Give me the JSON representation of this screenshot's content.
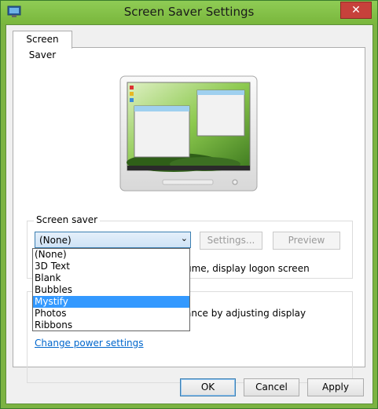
{
  "window": {
    "title": "Screen Saver Settings",
    "close_symbol": "✕"
  },
  "tabs": [
    {
      "label": "Screen Saver"
    }
  ],
  "screen_saver": {
    "group_label": "Screen saver",
    "selected": "(None)",
    "settings_label": "Settings...",
    "preview_label": "Preview",
    "logon_text": "ume, display logon screen",
    "options": [
      "(None)",
      "3D Text",
      "Blank",
      "Bubbles",
      "Mystify",
      "Photos",
      "Ribbons"
    ],
    "highlighted_option": "Mystify"
  },
  "power": {
    "text": "ance by adjusting display",
    "link": "Change power settings"
  },
  "buttons": {
    "ok": "OK",
    "cancel": "Cancel",
    "apply": "Apply"
  },
  "colors": {
    "title_bar": "#79b63c",
    "selection": "#3399ff",
    "link": "#0066cc"
  }
}
